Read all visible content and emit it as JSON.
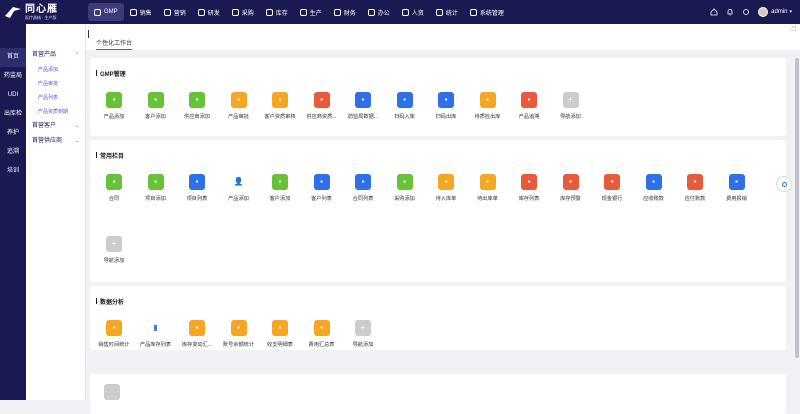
{
  "app": {
    "logo_title": "同心雁",
    "logo_subtitle": "医疗器械 · 生产版"
  },
  "topnav": [
    {
      "label": "GMP",
      "icon": "gmp-icon",
      "active": true
    },
    {
      "label": "销售",
      "icon": "chart-icon"
    },
    {
      "label": "营销",
      "icon": "bar-chart-icon"
    },
    {
      "label": "研发",
      "icon": "flask-icon"
    },
    {
      "label": "采购",
      "icon": "cart-icon"
    },
    {
      "label": "库存",
      "icon": "box-icon"
    },
    {
      "label": "生产",
      "icon": "plus-icon"
    },
    {
      "label": "财务",
      "icon": "yen-icon"
    },
    {
      "label": "办公",
      "icon": "folder-icon"
    },
    {
      "label": "人资",
      "icon": "person-icon"
    },
    {
      "label": "统计",
      "icon": "stats-icon"
    },
    {
      "label": "系统管理",
      "icon": "gear-icon"
    }
  ],
  "topright": {
    "user": "admin"
  },
  "search": {
    "placeholder": "搜索"
  },
  "rail": [
    "首页",
    "药监局",
    "UDI",
    "出库检",
    "养护",
    "追溯",
    "培训"
  ],
  "subnav": {
    "groups": [
      {
        "label": "首营产品",
        "items": [
          "产品添加",
          "产品审批",
          "产品列表",
          "产品资质到期"
        ]
      },
      {
        "label": "首营客户",
        "items": []
      },
      {
        "label": "首营供应商",
        "items": []
      }
    ]
  },
  "tab": {
    "label": "个性化工作台"
  },
  "sections": [
    {
      "title": "GMP管理",
      "tiles": [
        {
          "label": "产品添加",
          "color": "#67c23a",
          "icon": "plus-icon"
        },
        {
          "label": "客户添加",
          "color": "#67c23a",
          "icon": "user-add-icon"
        },
        {
          "label": "供应商添加",
          "color": "#67c23a",
          "icon": "store-icon"
        },
        {
          "label": "产品审批",
          "color": "#f5a623",
          "icon": "approve-icon"
        },
        {
          "label": "客户资质审核",
          "color": "#f5a623",
          "icon": "user-check-icon"
        },
        {
          "label": "供应商资质...",
          "color": "#e95a3d",
          "icon": "store-check-icon"
        },
        {
          "label": "药监局数据...",
          "color": "#2f6fe8",
          "icon": "data-icon"
        },
        {
          "label": "扫码入库",
          "color": "#2f6fe8",
          "icon": "scan-in-icon"
        },
        {
          "label": "扫码出库",
          "color": "#2f6fe8",
          "icon": "scan-out-icon"
        },
        {
          "label": "待质检出库",
          "color": "#f5a623",
          "icon": "inspect-icon"
        },
        {
          "label": "产品追溯",
          "color": "#e95a3d",
          "icon": "trace-icon"
        },
        {
          "label": "导航添加",
          "color": "#cccccc",
          "icon": "add-nav-icon"
        }
      ]
    },
    {
      "title": "常用栏目",
      "tiles": [
        {
          "label": "合同",
          "color": "#67c23a",
          "icon": "contract-icon"
        },
        {
          "label": "项目添加",
          "color": "#67c23a",
          "icon": "project-add-icon"
        },
        {
          "label": "项目列表",
          "color": "#2f6fe8",
          "icon": "layers-icon"
        },
        {
          "label": "产品添加",
          "color": "#ffffff",
          "icon": "person-photo-icon"
        },
        {
          "label": "客户添加",
          "color": "#67c23a",
          "icon": "user-add-icon"
        },
        {
          "label": "客户列表",
          "color": "#2f6fe8",
          "icon": "user-list-icon"
        },
        {
          "label": "合同列表",
          "color": "#2f6fe8",
          "icon": "contract-list-icon"
        },
        {
          "label": "采购添加",
          "color": "#67c23a",
          "icon": "purchase-icon"
        },
        {
          "label": "待入库单",
          "color": "#f5a623",
          "icon": "inbound-icon"
        },
        {
          "label": "待出库单",
          "color": "#f5a623",
          "icon": "outbound-icon"
        },
        {
          "label": "库存列表",
          "color": "#e95a3d",
          "icon": "stock-icon"
        },
        {
          "label": "库存预警",
          "color": "#e95a3d",
          "icon": "alert-icon"
        },
        {
          "label": "现金银行",
          "color": "#e95a3d",
          "icon": "bank-icon"
        },
        {
          "label": "应收账款",
          "color": "#2f6fe8",
          "icon": "receivable-icon"
        },
        {
          "label": "应付账款",
          "color": "#e95a3d",
          "icon": "payable-icon"
        },
        {
          "label": "费用报销",
          "color": "#2f6fe8",
          "icon": "expense-icon"
        },
        {
          "label": "导航添加",
          "color": "#cccccc",
          "icon": "add-nav-icon"
        }
      ]
    },
    {
      "title": "数据分析",
      "tiles": [
        {
          "label": "销售时间统计",
          "color": "#f5a623",
          "icon": "coins-icon"
        },
        {
          "label": "产品库存列表",
          "color": "#ffffff",
          "icon": "bar-chart-icon"
        },
        {
          "label": "库存变动汇...",
          "color": "#f5a623",
          "icon": "stock-change-icon"
        },
        {
          "label": "账号余额统计",
          "color": "#f5a623",
          "icon": "balance-icon"
        },
        {
          "label": "收支明细表",
          "color": "#f5a623",
          "icon": "ledger-icon"
        },
        {
          "label": "费用汇总表",
          "color": "#f5a623",
          "icon": "summary-icon"
        },
        {
          "label": "导航添加",
          "color": "#cccccc",
          "icon": "add-nav-icon"
        }
      ]
    }
  ]
}
